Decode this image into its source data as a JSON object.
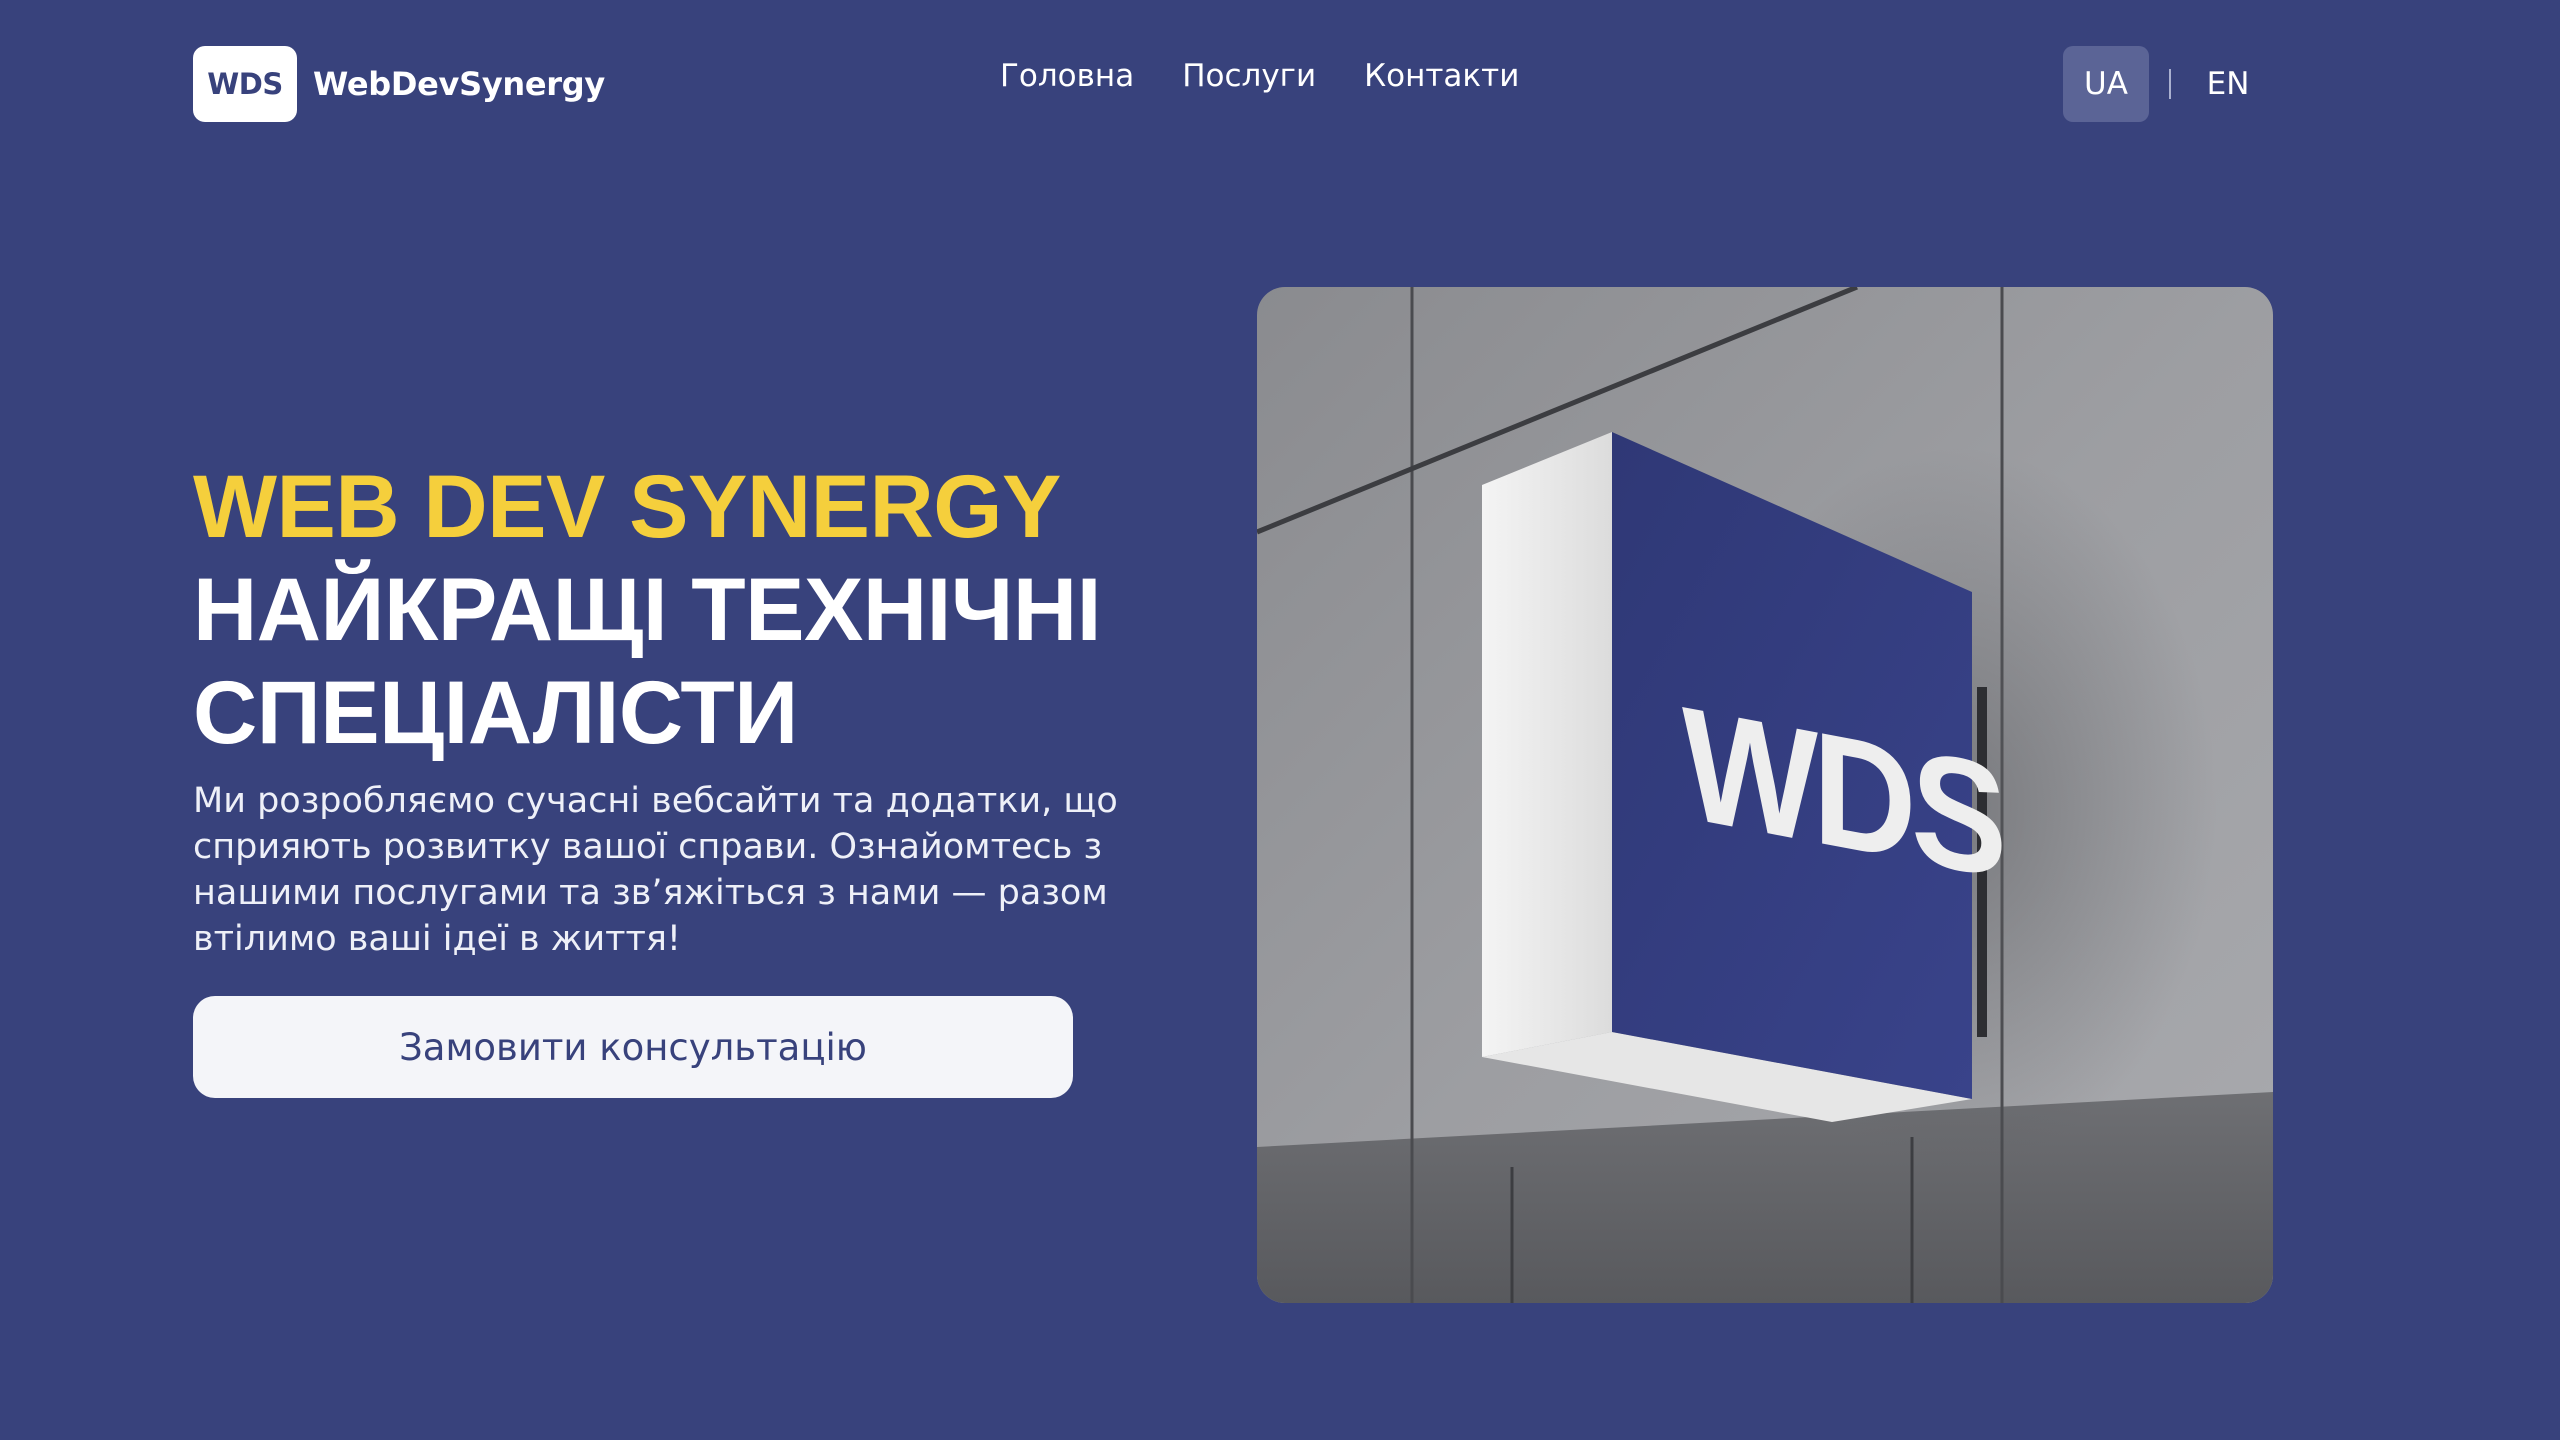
{
  "header": {
    "logo_badge": "WDS",
    "logo_text": "WebDevSynergy",
    "nav": [
      "Головна",
      "Послуги",
      "Контакти"
    ],
    "lang_active": "UA",
    "lang_other": "EN"
  },
  "hero": {
    "title_accent": "WEB DEV SYNERGY",
    "title_line1": "НАЙКРАЩІ ТЕХНІЧНІ",
    "title_line2": "СПЕЦІАЛІСТИ",
    "description": "Ми розробляємо сучасні вебсайти та додатки, що сприяють розвитку вашої справи. Ознайомтесь з нашими послугами та зв’яжіться з нами — разом втілимо ваші ідеї в життя!",
    "cta_label": "Замовити консультацію"
  },
  "photo": {
    "sign_text": "WDS"
  },
  "colors": {
    "background": "#38427c",
    "accent": "#f5cf3c",
    "sign_blue": "#323b7a",
    "button_bg": "#f4f5f9"
  }
}
